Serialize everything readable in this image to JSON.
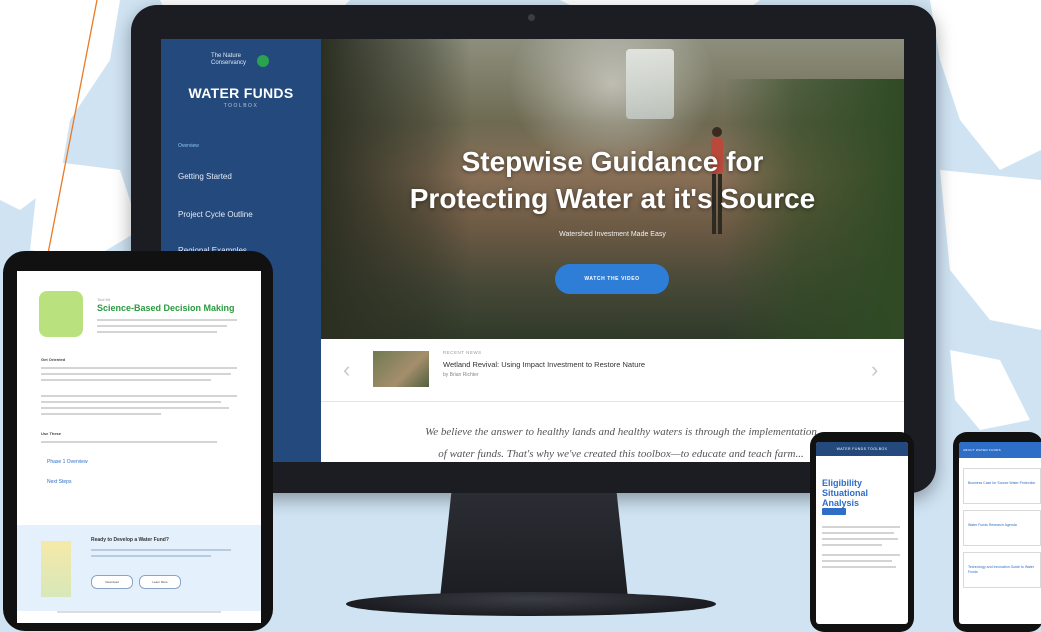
{
  "desktop": {
    "logo_text": "The Nature Conservancy",
    "brand_title": "WATER FUNDS",
    "brand_subtitle": "TOOLBOX",
    "nav": [
      {
        "label": "Overview"
      },
      {
        "label": "Getting Started"
      },
      {
        "label": "Project Cycle Outline"
      },
      {
        "label": "Regional Examples"
      }
    ],
    "hero_title_line1": "Stepwise Guidance for",
    "hero_title_line2": "Protecting Water at it's Source",
    "hero_subtitle": "Watershed Investment Made Easy",
    "watch_button": "WATCH THE VIDEO",
    "featured": {
      "label": "RECENT NEWS",
      "title": "Wetland Revival: Using Impact Investment to Restore Nature",
      "author": "by Brian Richter"
    },
    "quote_line1": "We believe the answer to healthy lands and healthy waters is through the implementation",
    "quote_line2": "of water funds. That's why we've created this toolbox—to educate and teach farm..."
  },
  "tablet": {
    "kicker": "Tool Kit",
    "title": "Science-Based Decision Making",
    "section_1": "Get Oriented",
    "section_2": "Use These",
    "items": [
      {
        "label": "Phase 1 Overview"
      },
      {
        "label": "Next Steps"
      }
    ],
    "band_title": "Ready to Develop a Water Fund?",
    "band_buttons": [
      "Download",
      "Learn More"
    ]
  },
  "phone_left": {
    "header": "WATER FUNDS TOOLBOX",
    "title": "Eligibility Situational Analysis"
  },
  "phone_right": {
    "header": "ABOUT WATER FUNDS",
    "cards": [
      {
        "text": "Business Case for Source Water Protection"
      },
      {
        "text": "Water Funds Research Agenda"
      },
      {
        "text": "Technology and Innovation Guide to Water Funds"
      }
    ]
  },
  "colors": {
    "sidebar": "#24497d",
    "accent": "#2e7dd6",
    "green": "#2a9b3f",
    "background": "#cfe3f3"
  }
}
